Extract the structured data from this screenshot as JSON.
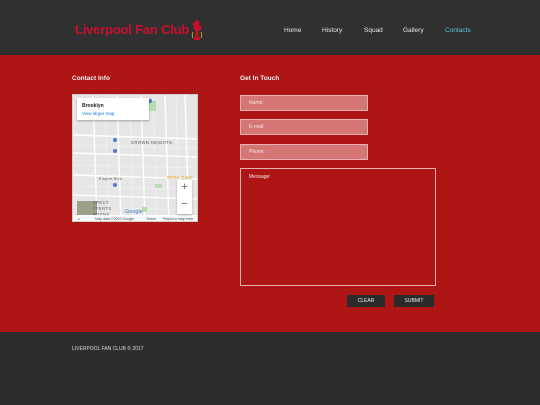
{
  "header": {
    "logo_text": "Liverpool Fan Club",
    "nav": [
      "Home",
      "History",
      "Squad",
      "Gallery",
      "Contacts"
    ],
    "active_nav": "Contacts"
  },
  "contact": {
    "title": "Contact Info",
    "map": {
      "place": "Brooklyn",
      "link": "View larger map",
      "labels": [
        "CROWN HEIGHTS",
        "White Castl",
        "SPECT",
        "FFERTS",
        "RDENS",
        "Empire Blvd"
      ],
      "zoom_in": "+",
      "zoom_out": "−",
      "footer": [
        "Map data ©2023 Google",
        "Terms",
        "Report a map error"
      ],
      "brand": "Google"
    }
  },
  "form": {
    "title": "Get In Touch",
    "name_placeholder": "Name:",
    "email_placeholder": "E-mail:",
    "phone_placeholder": "Phone:",
    "message_placeholder": "Message:",
    "clear_label": "CLEAR",
    "submit_label": "SUBMIT"
  },
  "footer": {
    "copyright": "LIVERPOOL FAN CLUB © 2017"
  },
  "colors": {
    "header_bg": "#303030",
    "main_bg": "#ae1616",
    "logo": "#c8102e",
    "active_nav": "#5fc8d8",
    "field_bg": "#d47676",
    "button_bg": "#2b2b2b"
  }
}
